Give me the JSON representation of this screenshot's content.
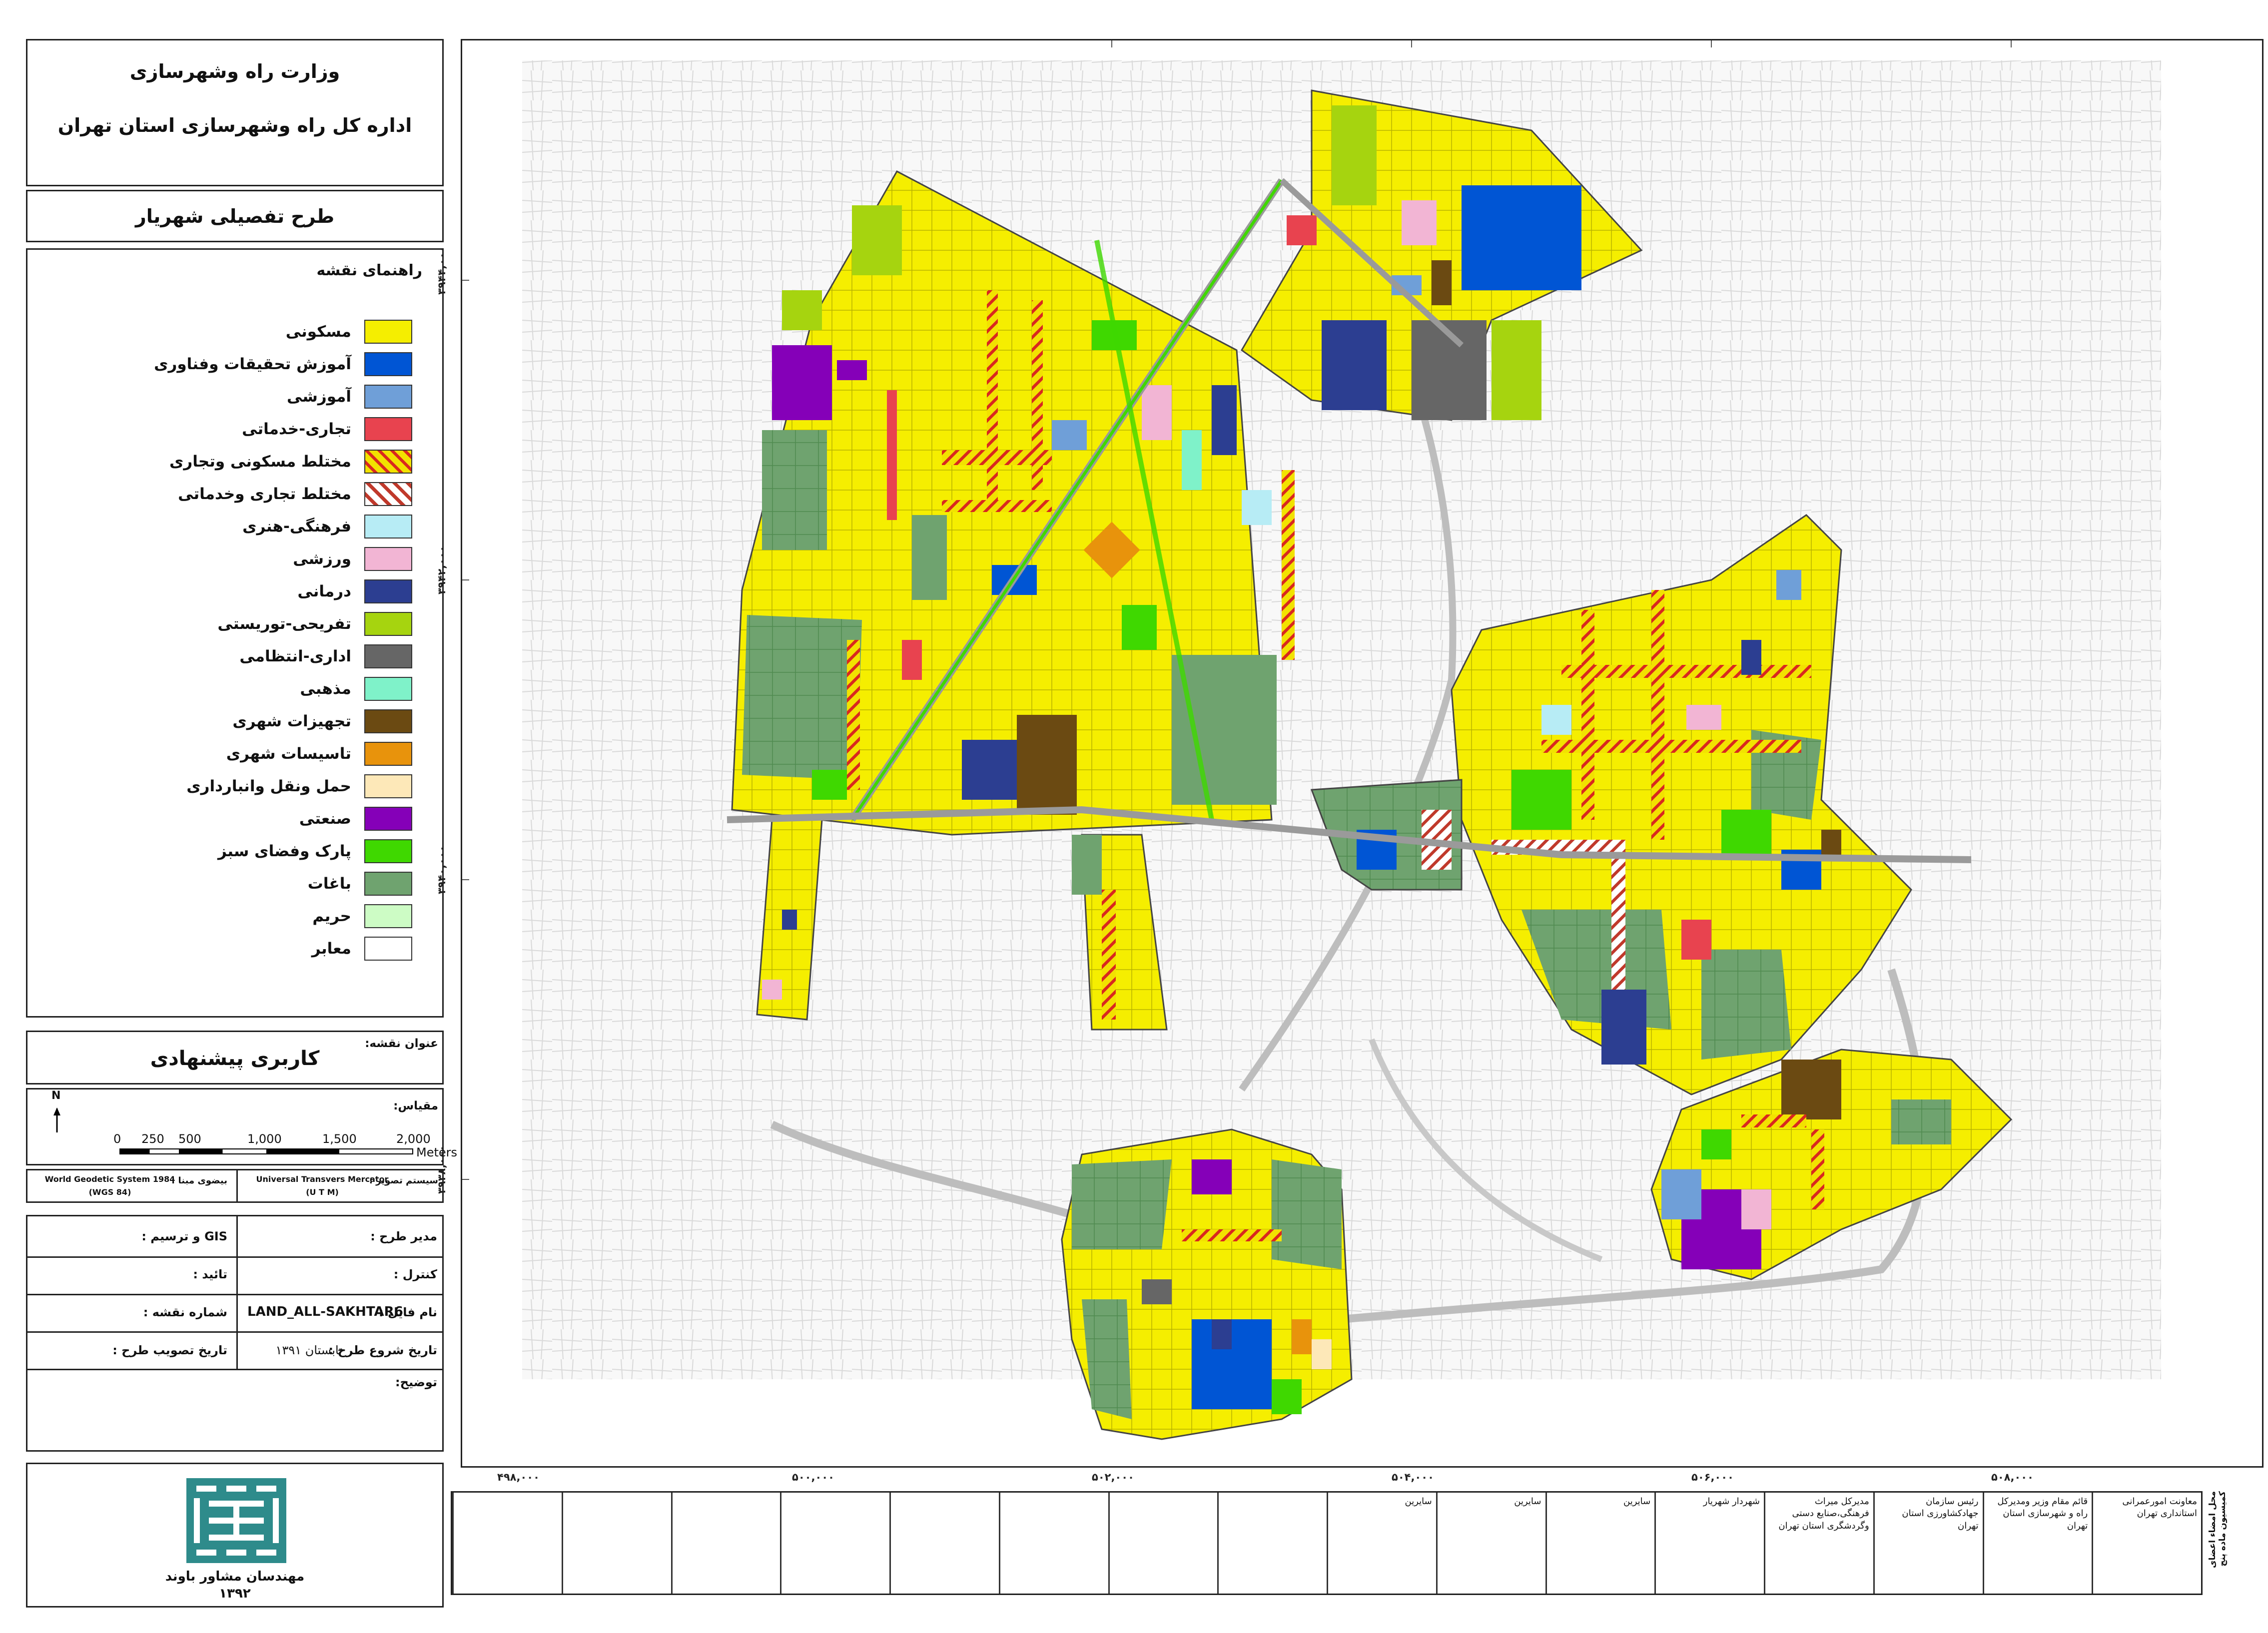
{
  "header": {
    "ministry": "وزارت راه وشهرسازی",
    "directorate": "اداره کل راه وشهرسازی استان تهران",
    "plan_title": "طرح تفصیلی شهریار"
  },
  "legend": {
    "title": "راهنمای نقشه",
    "items": [
      {
        "label": "مسکونی",
        "color": "#f5ee00",
        "pattern": "solid"
      },
      {
        "label": "آموزش تحقیقات وفناوری",
        "color": "#0055d4",
        "pattern": "solid"
      },
      {
        "label": "آموزشی",
        "color": "#6f9fd8",
        "pattern": "solid"
      },
      {
        "label": "تجاری-خدماتی",
        "color": "#e8434f",
        "pattern": "solid"
      },
      {
        "label": "مختلط مسکونی وتجاری",
        "color": "#f2e200",
        "pattern": "hatch-res"
      },
      {
        "label": "مختلط تجاری وخدماتی",
        "color": "#c0392b",
        "pattern": "hatch-com"
      },
      {
        "label": "فرهنگی-هنری",
        "color": "#b7ecf5",
        "pattern": "solid"
      },
      {
        "label": "ورزشی",
        "color": "#f2b5d4",
        "pattern": "solid"
      },
      {
        "label": "درمانی",
        "color": "#2c3e91",
        "pattern": "solid"
      },
      {
        "label": "تفریحی-توریستی",
        "color": "#a6d40f",
        "pattern": "solid"
      },
      {
        "label": "اداری-انتظامی",
        "color": "#666666",
        "pattern": "solid"
      },
      {
        "label": "مذهبی",
        "color": "#7ff2c9",
        "pattern": "solid"
      },
      {
        "label": "تجهیزات شهری",
        "color": "#6b4a12",
        "pattern": "solid"
      },
      {
        "label": "تاسیسات شهری",
        "color": "#e8930c",
        "pattern": "solid"
      },
      {
        "label": "حمل ونقل وانبارداری",
        "color": "#fde8b8",
        "pattern": "solid"
      },
      {
        "label": "صنعتی",
        "color": "#8500b8",
        "pattern": "solid"
      },
      {
        "label": "پارک وفضای سبز",
        "color": "#3fd800",
        "pattern": "solid"
      },
      {
        "label": "باغات",
        "color": "#6fa36f",
        "pattern": "solid"
      },
      {
        "label": "حریم",
        "color": "#cdfcc5",
        "pattern": "solid"
      },
      {
        "label": "معابر",
        "color": "#ffffff",
        "pattern": "solid"
      }
    ]
  },
  "map_title": {
    "label": "عنوان نقشه:",
    "value": "کاربری پیشنهادی"
  },
  "scale": {
    "label": "مقیاس:",
    "north": "N",
    "ticks": [
      "0",
      "250",
      "500",
      "1,000",
      "1,500",
      "2,000"
    ],
    "unit": "Meters"
  },
  "projection": {
    "system_label": "سیستم تصویر :",
    "system_value": "Universal Transvers Mercator",
    "system_abbr": "(U T M)",
    "datum_label": "بیضوی مبنا :",
    "datum_value": "World Geodetic System  1984",
    "datum_abbr": "(WGS 84)"
  },
  "info": {
    "manager_label": "مدیر طرح :",
    "gis_label": "GIS و ترسیم :",
    "control_label": "کنترل :",
    "approval_label": "تائید :",
    "file_label": "نام فایل :",
    "file_value": "LAND_ALL-SAKHTAR6",
    "sheet_label": "شماره نقشه :",
    "start_label": "تاریخ شروع طرح :",
    "start_value": "تابستان ۱۳۹۱",
    "approve_date_label": "تاریخ تصویب طرح :",
    "notes_label": "توضیح:"
  },
  "consultant": {
    "name": "مهندسان مشاور باوند",
    "year": "۱۳۹۲"
  },
  "signatures": [
    "معاونت امورعمرانی استانداری تهران",
    "قائم مقام وزیر ومدیرکل راه و شهرسازی استان تهران",
    "رئیس سازمان جهادکشاورزی استان تهران",
    "مدیرکل میراث فرهنگی،صنایع دستی وگردشگری استان تهران",
    "شهردار شهریار",
    "سایرین",
    "سایرین",
    "سایرین",
    "",
    "",
    "",
    "",
    "",
    "",
    "",
    ""
  ],
  "signature_header": "محل امضاء اعضای کمیسیون ماده پنج",
  "coords": {
    "x": [
      "۴۹۸,۰۰۰",
      "۵۰۰,۰۰۰",
      "۵۰۲,۰۰۰",
      "۵۰۴,۰۰۰",
      "۵۰۶,۰۰۰",
      "۵۰۸,۰۰۰"
    ],
    "y": [
      "۳۹۴۴,۰۰۰",
      "۳۹۴۲,۰۰۰",
      "۳۹۴۰,۰۰۰",
      "۳۹۳۸,۰۰۰"
    ]
  }
}
